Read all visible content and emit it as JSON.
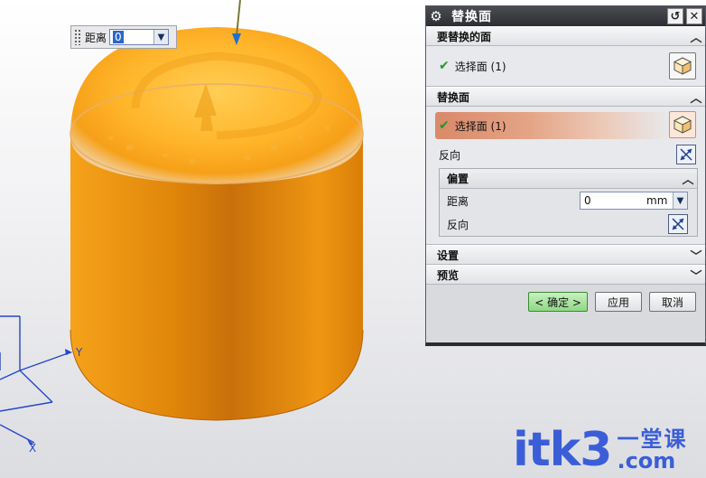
{
  "viewport": {
    "float_input": {
      "label": "距离",
      "value": "0"
    },
    "axis_y_label": "Y",
    "axis_x_label": "X"
  },
  "dialog": {
    "title": "替换面",
    "sections": {
      "faces_to_replace": {
        "header": "要替换的面",
        "select_label": "选择面 (1)"
      },
      "replacement_face": {
        "header": "替换面",
        "select_label": "选择面 (1)",
        "reverse_label": "反向",
        "offset": {
          "header": "偏置",
          "distance_label": "距离",
          "distance_value": "0",
          "unit": "mm",
          "reverse_label": "反向"
        }
      },
      "settings": {
        "header": "设置"
      },
      "preview": {
        "header": "预览"
      }
    },
    "buttons": {
      "ok": "< 确定 >",
      "apply": "应用",
      "cancel": "取消"
    }
  },
  "watermark": {
    "main": "itk3",
    "cn": "一堂课",
    "suffix": ".com"
  },
  "colors": {
    "model_orange": "#f39a0b",
    "highlight": "#d9896a",
    "accent_blue": "#2b67c8",
    "watermark": "#3b5ed8"
  }
}
